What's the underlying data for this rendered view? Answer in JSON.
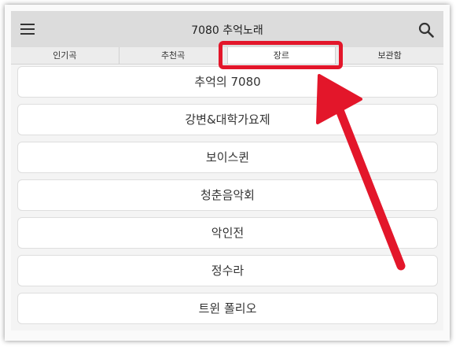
{
  "app": {
    "title": "7080 추억노래"
  },
  "tabs": [
    {
      "label": "인기곡"
    },
    {
      "label": "추천곡"
    },
    {
      "label": "장르"
    },
    {
      "label": "보관함"
    }
  ],
  "genres": [
    {
      "label": "추억의 7080"
    },
    {
      "label": "강변&대학가요제"
    },
    {
      "label": "보이스퀸"
    },
    {
      "label": "청춘음악회"
    },
    {
      "label": "악인전"
    },
    {
      "label": "정수라"
    },
    {
      "label": "트윈 폴리오"
    }
  ],
  "icons": {
    "menu": "menu-icon",
    "search": "search-icon"
  },
  "colors": {
    "annotation": "#e3162a",
    "appbar": "#dcdcdc"
  }
}
